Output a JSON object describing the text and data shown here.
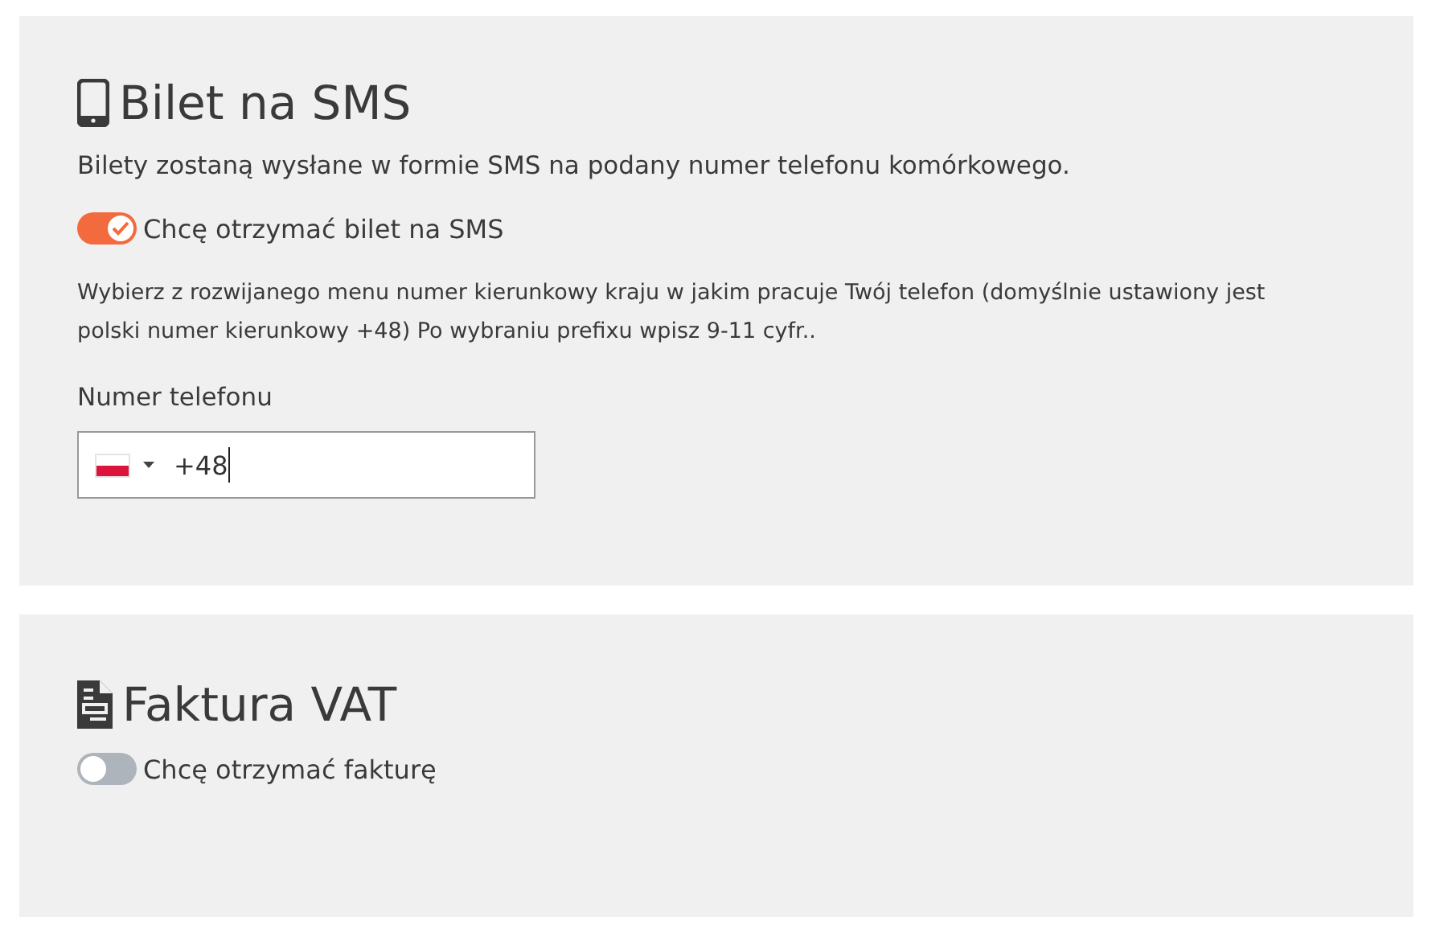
{
  "sections": [
    {
      "kind": "phone",
      "title": "Bilet na SMS",
      "description": "Bilety zostaną wysłane w formie SMS na podany numer telefonu komórkowego.",
      "toggle": {
        "label": "Chcę otrzymać bilet na SMS",
        "on": true
      },
      "hint": "Wybierz z rozwijanego menu numer kierunkowy kraju w jakim pracuje Twój telefon (domyślnie ustawiony jest polski numer kierunkowy +48) Po wybraniu prefixu wpisz 9-11 cyfr..",
      "phone_field": {
        "label": "Numer telefonu",
        "value": "+48"
      }
    },
    {
      "kind": "document",
      "title": "Faktura VAT",
      "toggle": {
        "label": "Chcę otrzymać fakturę",
        "on": false
      }
    }
  ]
}
